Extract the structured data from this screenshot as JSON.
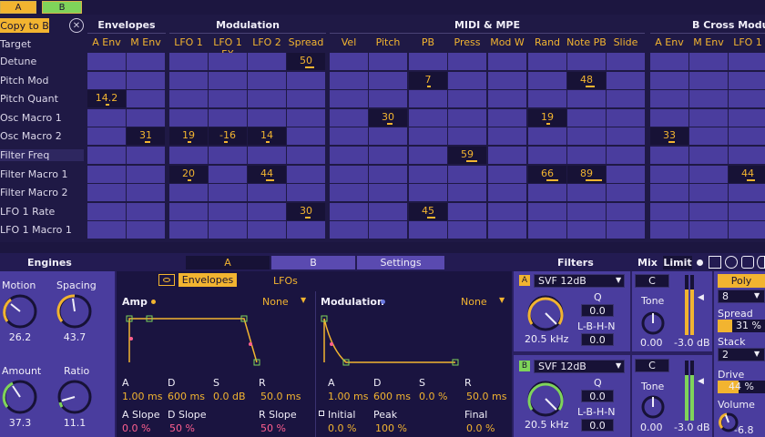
{
  "selector": {
    "a": "A",
    "b": "B"
  },
  "matrix": {
    "copy_label": "Copy to B",
    "target_label": "Target",
    "groups": [
      {
        "title": "Envelopes"
      },
      {
        "title": "Modulation"
      },
      {
        "title": "MIDI & MPE"
      },
      {
        "title": "B Cross Modu"
      }
    ],
    "columns": [
      "A Env",
      "M Env",
      "LFO 1",
      "LFO 1 FX",
      "LFO 2",
      "Spread",
      "Vel",
      "Pitch",
      "PB",
      "Press",
      "Mod W",
      "Rand",
      "Note PB",
      "Slide",
      "A Env",
      "M Env",
      "LFO 1"
    ],
    "rows": [
      "Detune",
      "Pitch Mod",
      "Pitch Quant",
      "Osc Macro 1",
      "Osc Macro 2",
      "Filter Freq",
      "Filter Macro 1",
      "Filter Macro 2",
      "LFO 1 Rate",
      "LFO 1 Macro 1"
    ],
    "values": [
      {
        "row": 0,
        "col": 5,
        "v": "50"
      },
      {
        "row": 1,
        "col": 8,
        "v": "7"
      },
      {
        "row": 1,
        "col": 12,
        "v": "48"
      },
      {
        "row": 2,
        "col": 0,
        "v": "14.2"
      },
      {
        "row": 3,
        "col": 7,
        "v": "30"
      },
      {
        "row": 3,
        "col": 11,
        "v": "19"
      },
      {
        "row": 4,
        "col": 1,
        "v": "31"
      },
      {
        "row": 4,
        "col": 2,
        "v": "19"
      },
      {
        "row": 4,
        "col": 3,
        "v": "-16"
      },
      {
        "row": 4,
        "col": 4,
        "v": "14"
      },
      {
        "row": 4,
        "col": 14,
        "v": "33"
      },
      {
        "row": 5,
        "col": 9,
        "v": "59"
      },
      {
        "row": 6,
        "col": 2,
        "v": "20"
      },
      {
        "row": 6,
        "col": 4,
        "v": "44"
      },
      {
        "row": 6,
        "col": 11,
        "v": "66"
      },
      {
        "row": 6,
        "col": 12,
        "v": "89"
      },
      {
        "row": 6,
        "col": 16,
        "v": "44"
      },
      {
        "row": 8,
        "col": 5,
        "v": "30"
      },
      {
        "row": 8,
        "col": 8,
        "v": "45"
      }
    ]
  },
  "bottom": {
    "engines": "Engines",
    "tab_a": "A",
    "tab_b": "B",
    "tab_settings": "Settings",
    "filters": "Filters",
    "mix": "Mix",
    "limit": "Limit",
    "knobs": {
      "motion": {
        "label": "Motion",
        "value": "26.2"
      },
      "spacing": {
        "label": "Spacing",
        "value": "43.7"
      },
      "amount": {
        "label": "Amount",
        "value": "37.3"
      },
      "ratio": {
        "label": "Ratio",
        "value": "11.1"
      }
    },
    "env": {
      "envelopes_tab": "Envelopes",
      "lfos_tab": "LFOs",
      "amp": "Amp",
      "amp_none": "None",
      "mod": "Modulation",
      "mod_none": "None",
      "amp_params": {
        "a_l": "A",
        "a_v": "1.00 ms",
        "d_l": "D",
        "d_v": "600 ms",
        "s_l": "S",
        "s_v": "0.0 dB",
        "r_l": "R",
        "r_v": "50.0 ms"
      },
      "amp_slopes": {
        "a_l": "A Slope",
        "a_v": "0.0 %",
        "d_l": "D Slope",
        "d_v": "50 %",
        "r_l": "R Slope",
        "r_v": "50 %"
      },
      "mod_params": {
        "a_l": "A",
        "a_v": "1.00 ms",
        "d_l": "D",
        "d_v": "600 ms",
        "s_l": "S",
        "s_v": "0.0 %",
        "r_l": "R",
        "r_v": "50.0 ms"
      },
      "mod_slopes": {
        "i_l": "Initial",
        "i_v": "0.0 %",
        "p_l": "Peak",
        "p_v": "100 %",
        "f_l": "Final",
        "f_v": "0.0 %"
      }
    },
    "filter_a": {
      "tag": "A",
      "type": "SVF 12dB",
      "q": "Q",
      "q_v": "0.0",
      "lbhn": "L-B-H-N",
      "lbhn_v": "0.0",
      "freq": "20.5 kHz"
    },
    "filter_b": {
      "tag": "B",
      "type": "SVF 12dB",
      "q": "Q",
      "q_v": "0.0",
      "lbhn": "L-B-H-N",
      "lbhn_v": "0.0",
      "freq": "20.5 kHz"
    },
    "mix_a": {
      "c": "C",
      "tone": "Tone",
      "tone_v": "0.00",
      "db": "-3.0 dB"
    },
    "mix_b": {
      "c": "C",
      "tone": "Tone",
      "tone_v": "0.00",
      "db": "-3.0 dB"
    },
    "voice": {
      "poly": "Poly",
      "voices": "8",
      "spread": "Spread",
      "spread_v": "31 %",
      "stack": "Stack",
      "stack_v": "2",
      "drive": "Drive",
      "drive_v": "44 %",
      "volume": "Volume",
      "volume_v": "-6.8 dB"
    }
  },
  "colors": {
    "accent": "#f2b430",
    "cell": "#4a3d9e",
    "panel": "#2a2060"
  }
}
